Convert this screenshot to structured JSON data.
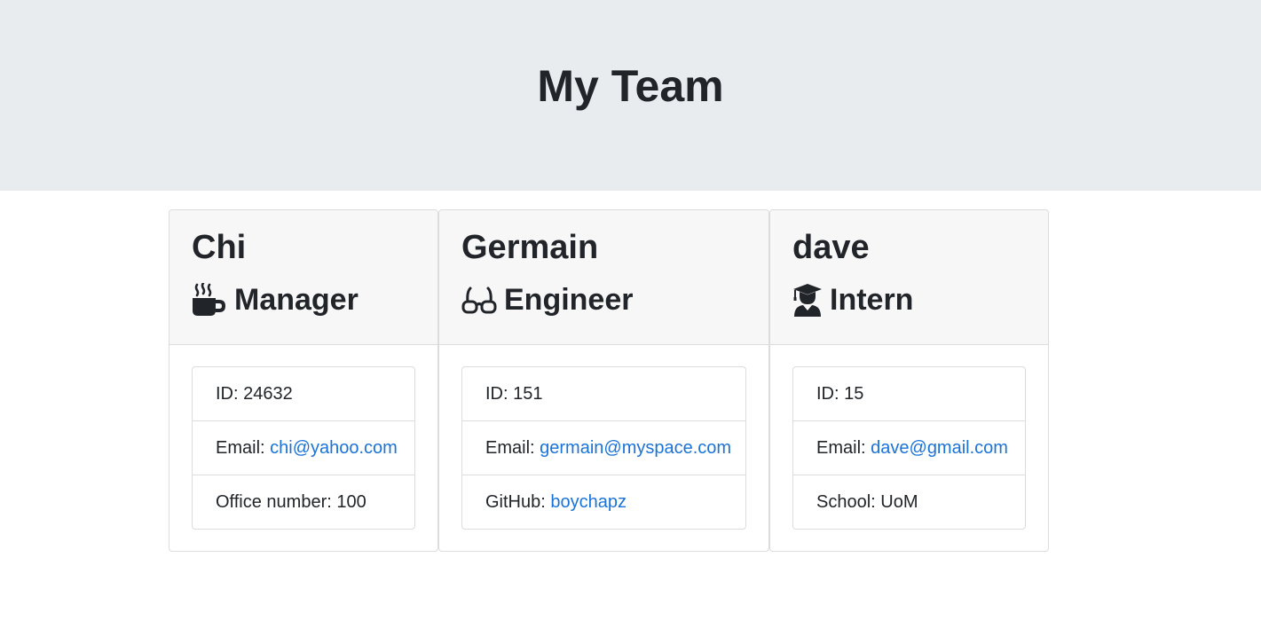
{
  "header": {
    "title": "My Team"
  },
  "cards": [
    {
      "name": "Chi",
      "role": "Manager",
      "role_icon": "mug-icon",
      "id_label": "ID:",
      "id": "24632",
      "email_label": "Email:",
      "email": "chi@yahoo.com",
      "extra_label": "Office number:",
      "extra_value": "100"
    },
    {
      "name": "Germain",
      "role": "Engineer",
      "role_icon": "glasses-icon",
      "id_label": "ID:",
      "id": "151",
      "email_label": "Email:",
      "email": "germain@myspace.com",
      "extra_label": "GitHub:",
      "extra_value": "boychapz"
    },
    {
      "name": "dave",
      "role": "Intern",
      "role_icon": "graduate-icon",
      "id_label": "ID:",
      "id": "15",
      "email_label": "Email:",
      "email": "dave@gmail.com",
      "extra_label": "School:",
      "extra_value": "UoM"
    }
  ],
  "colors": {
    "header_bg": "#e9ecef",
    "link": "#1a73d9",
    "card_header_bg": "#f7f7f7"
  }
}
